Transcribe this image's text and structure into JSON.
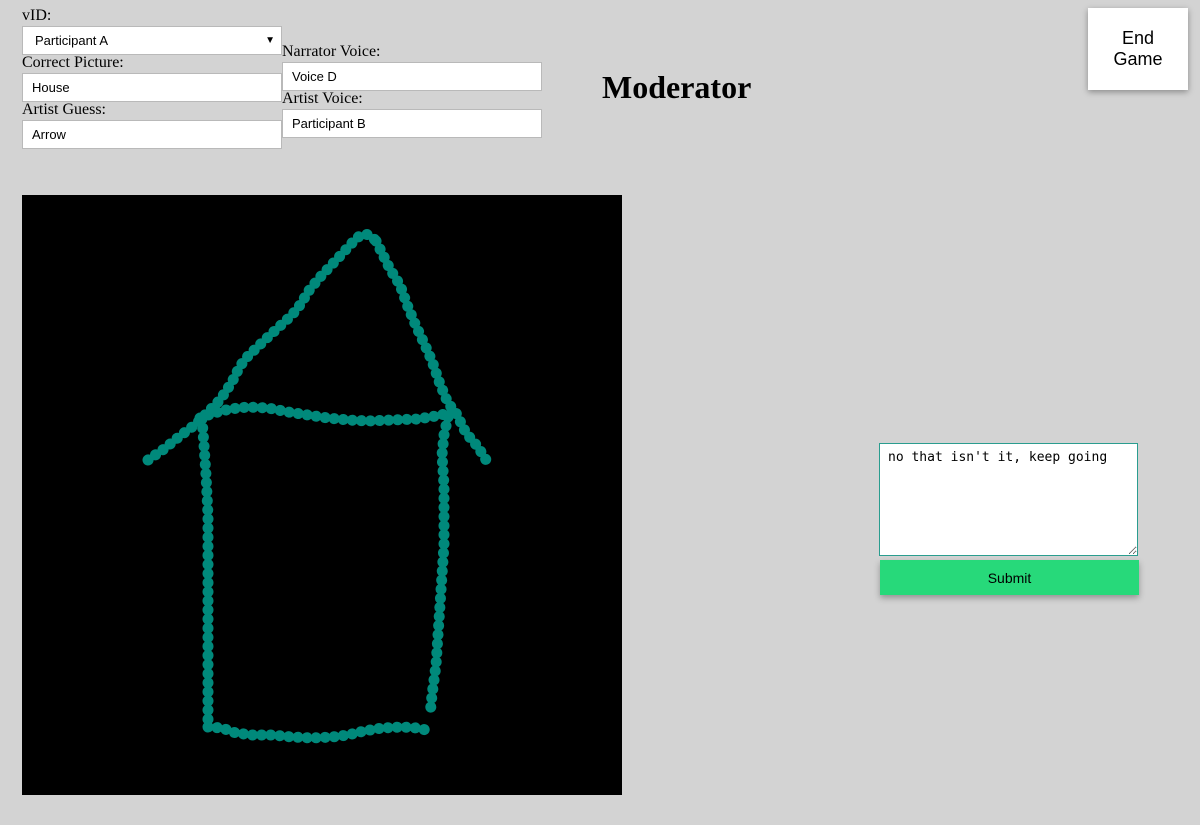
{
  "form": {
    "vid_label": "vID:",
    "vid_selected": "Participant A",
    "correct_picture_label": "Correct Picture:",
    "correct_picture_value": "House",
    "artist_guess_label": "Artist Guess:",
    "artist_guess_value": "Arrow",
    "narrator_voice_label": "Narrator Voice:",
    "narrator_voice_value": "Voice D",
    "artist_voice_label": "Artist Voice:",
    "artist_voice_value": "Participant B"
  },
  "header": {
    "title": "Moderator",
    "end_game_label": "End Game"
  },
  "drawing": {
    "background_color": "#000000",
    "stroke_color": "#00897b",
    "subject": "house sketch"
  },
  "chat": {
    "message_value": "no that isn't it, keep going",
    "submit_label": "Submit"
  },
  "colors": {
    "page_background": "#d3d3d3",
    "submit_button": "#27d97a",
    "chat_border": "#2a9d8f"
  },
  "icons": {
    "select_caret": "caret-down-icon"
  }
}
